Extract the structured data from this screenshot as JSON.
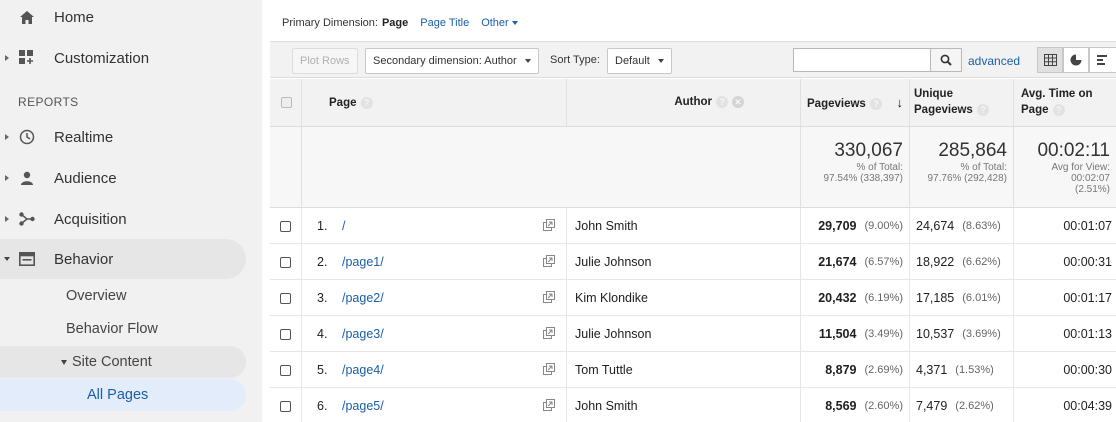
{
  "sidebar": {
    "home": "Home",
    "customization": "Customization",
    "reports_label": "REPORTS",
    "realtime": "Realtime",
    "audience": "Audience",
    "acquisition": "Acquisition",
    "behavior": "Behavior",
    "overview": "Overview",
    "behavior_flow": "Behavior Flow",
    "site_content": "Site Content",
    "all_pages": "All Pages"
  },
  "primary_dimension": {
    "label": "Primary Dimension:",
    "selected": "Page",
    "page_title": "Page Title",
    "other": "Other"
  },
  "toolbar": {
    "plot_rows": "Plot Rows",
    "secondary_dimension": "Secondary dimension: Author",
    "sort_type_label": "Sort Type:",
    "sort_type_value": "Default",
    "search_value": "",
    "advanced": "advanced"
  },
  "table": {
    "headers": {
      "page": "Page",
      "author": "Author",
      "pageviews": "Pageviews",
      "unique_pageviews_1": "Unique",
      "unique_pageviews_2": "Pageviews",
      "avg_time_1": "Avg. Time on",
      "avg_time_2": "Page"
    },
    "totals": {
      "pageviews": "330,067",
      "pageviews_pct_label": "% of Total:",
      "pageviews_pct": "97.54% (338,397)",
      "unique": "285,864",
      "unique_pct_label": "% of Total:",
      "unique_pct": "97.76% (292,428)",
      "avg_time": "00:02:11",
      "avg_time_label": "Avg for View:",
      "avg_time_view": "00:02:07",
      "avg_time_diff": "(2.51%)"
    },
    "rows": [
      {
        "num": "1.",
        "page": "/",
        "author": "John Smith",
        "pageviews": "29,709",
        "pv_pct": "(9.00%)",
        "unique": "24,674",
        "u_pct": "(8.63%)",
        "avg_time": "00:01:07"
      },
      {
        "num": "2.",
        "page": "/page1/",
        "author": "Julie Johnson",
        "pageviews": "21,674",
        "pv_pct": "(6.57%)",
        "unique": "18,922",
        "u_pct": "(6.62%)",
        "avg_time": "00:00:31"
      },
      {
        "num": "3.",
        "page": "/page2/",
        "author": "Kim Klondike",
        "pageviews": "20,432",
        "pv_pct": "(6.19%)",
        "unique": "17,185",
        "u_pct": "(6.01%)",
        "avg_time": "00:01:17"
      },
      {
        "num": "4.",
        "page": "/page3/",
        "author": "Julie Johnson",
        "pageviews": "11,504",
        "pv_pct": "(3.49%)",
        "unique": "10,537",
        "u_pct": "(3.69%)",
        "avg_time": "00:01:13"
      },
      {
        "num": "5.",
        "page": "/page4/",
        "author": "Tom Tuttle",
        "pageviews": "8,879",
        "pv_pct": "(2.69%)",
        "unique": "4,371",
        "u_pct": "(1.53%)",
        "avg_time": "00:00:30"
      },
      {
        "num": "6.",
        "page": "/page5/",
        "author": "John Smith",
        "pageviews": "8,569",
        "pv_pct": "(2.60%)",
        "unique": "7,479",
        "u_pct": "(2.62%)",
        "avg_time": "00:04:39"
      }
    ]
  },
  "colors": {
    "link": "#1a5fa8",
    "sidebar_bg": "#f1f1f1",
    "active_pill": "#e2ecfb"
  }
}
